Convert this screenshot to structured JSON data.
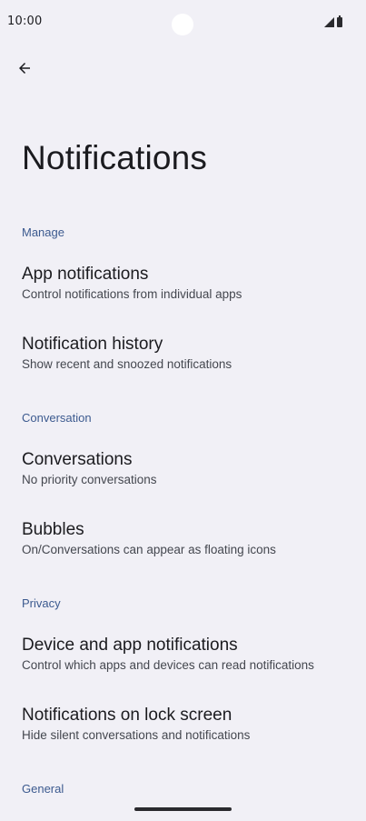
{
  "status_bar": {
    "time": "10:00"
  },
  "header": {
    "title": "Notifications"
  },
  "sections": [
    {
      "header": "Manage",
      "items": [
        {
          "title": "App notifications",
          "subtitle": "Control notifications from individual apps"
        },
        {
          "title": "Notification history",
          "subtitle": "Show recent and snoozed notifications"
        }
      ]
    },
    {
      "header": "Conversation",
      "items": [
        {
          "title": "Conversations",
          "subtitle": "No priority conversations"
        },
        {
          "title": "Bubbles",
          "subtitle": "On/Conversations can appear as floating icons"
        }
      ]
    },
    {
      "header": "Privacy",
      "items": [
        {
          "title": "Device and app notifications",
          "subtitle": "Control which apps and devices can read notifications"
        },
        {
          "title": "Notifications on lock screen",
          "subtitle": "Hide silent conversations and notifications"
        }
      ]
    },
    {
      "header": "General",
      "items": []
    }
  ]
}
